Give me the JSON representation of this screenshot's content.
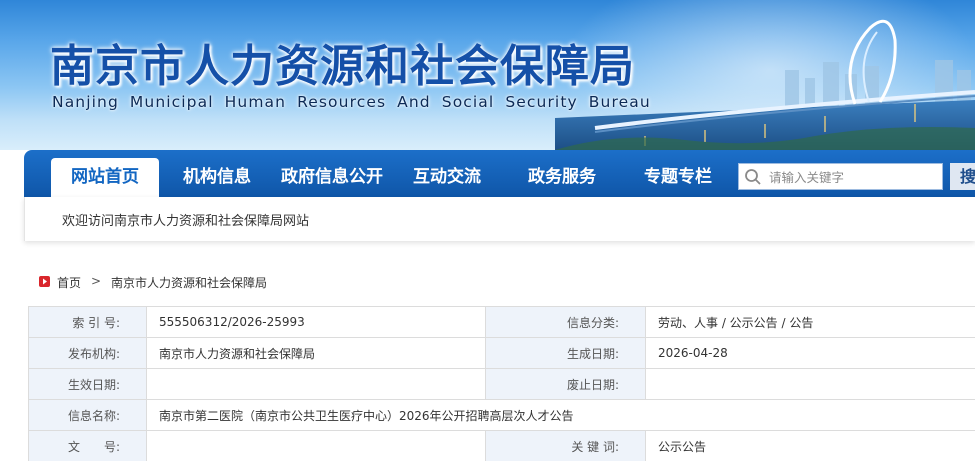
{
  "header": {
    "title_cn": "南京市人力资源和社会保障局",
    "title_en": "Nanjing Municipal Human Resources And Social Security Bureau"
  },
  "nav": {
    "items": [
      "网站首页",
      "机构信息",
      "政府信息公开",
      "互动交流",
      "政务服务",
      "专题专栏"
    ],
    "active": "网站首页",
    "search_placeholder": "请输入关键字",
    "search_button": "搜"
  },
  "welcome": {
    "text": "欢迎访问南京市人力资源和社会保障局网站"
  },
  "breadcrumb": {
    "home": "首页",
    "separator": ">",
    "current": "南京市人力资源和社会保障局"
  },
  "info": {
    "index_label": "索 引 号:",
    "index_value": "555506312/2026-25993",
    "category_label": "信息分类:",
    "category_value": "劳动、人事 / 公示公告 / 公告",
    "publisher_label": "发布机构:",
    "publisher_value": "南京市人力资源和社会保障局",
    "created_label": "生成日期:",
    "created_value": "2026-04-28",
    "effective_label": "生效日期:",
    "effective_value": "",
    "repeal_label": "废止日期:",
    "repeal_value": "",
    "name_label": "信息名称:",
    "name_value": "南京市第二医院（南京市公共卫生医疗中心）2026年公开招聘高层次人才公告",
    "doc_no_label": "文　　号:",
    "doc_no_value": "",
    "keywords_label": "关 键 词:",
    "keywords_value": "公示公告"
  },
  "colors": {
    "nav_blue": "#1266c2",
    "title_blue": "#1550a8",
    "label_bg": "#eef3fa",
    "home_red": "#d9262c"
  },
  "icons": [
    "search-icon",
    "home-icon"
  ]
}
